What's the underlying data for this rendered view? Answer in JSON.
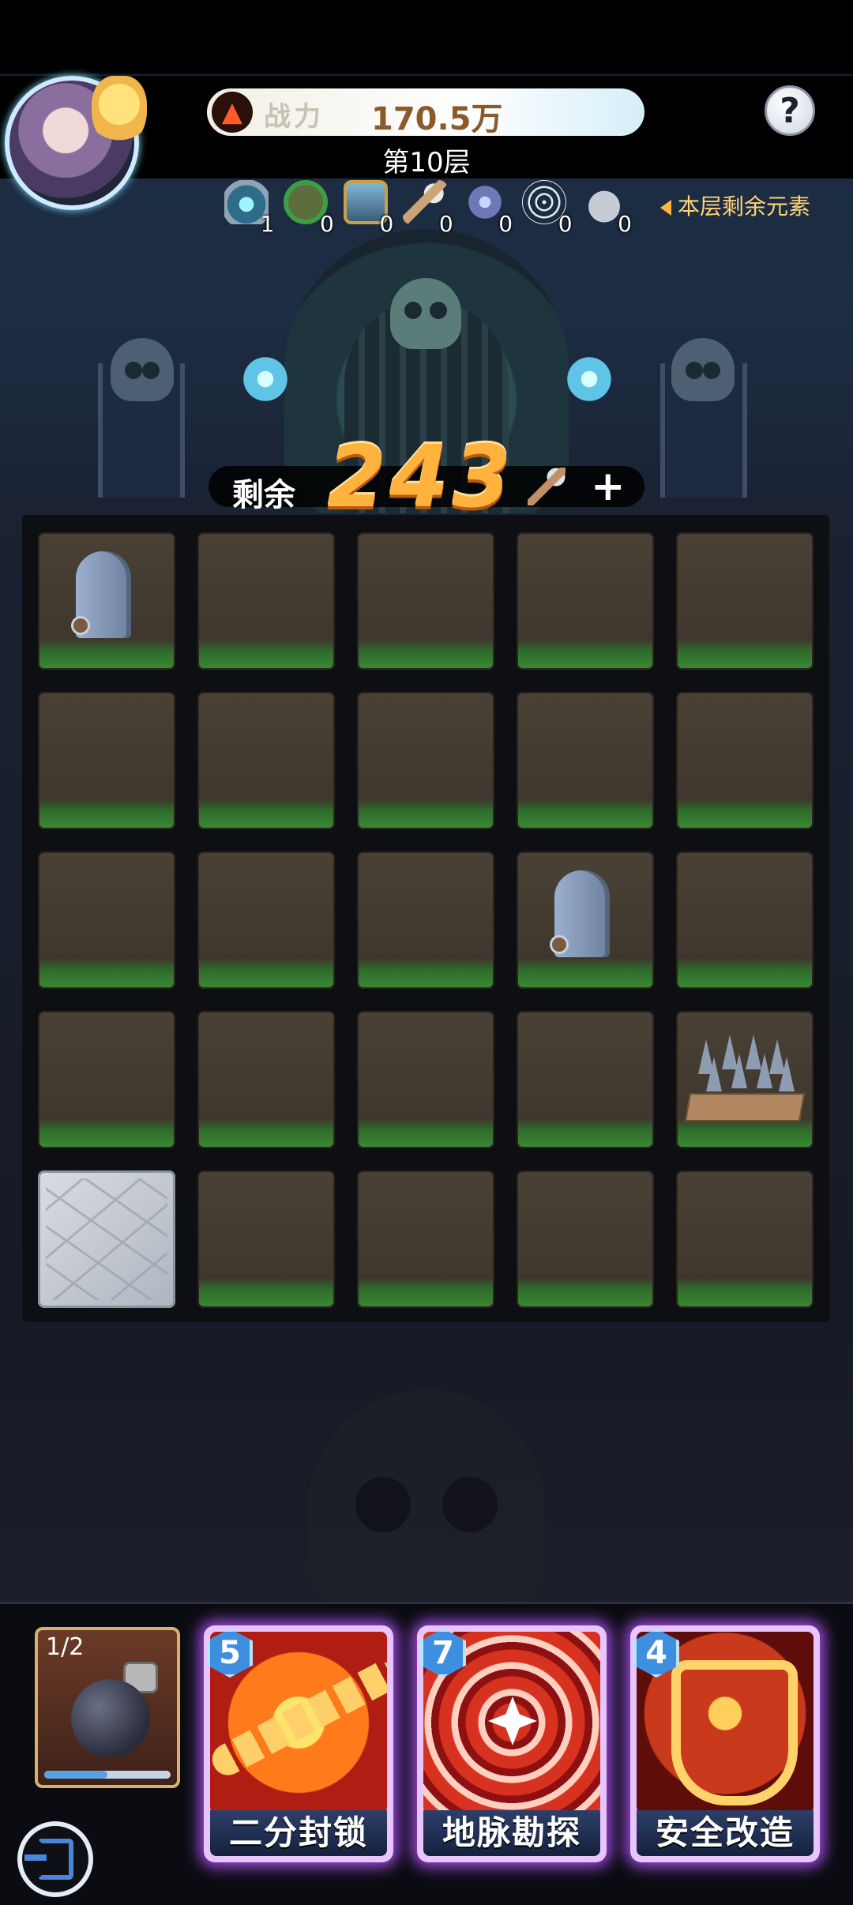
{
  "header": {
    "power_label": "战力",
    "power_value": "170.5万",
    "floor": "第10层",
    "help_glyph": "?",
    "remaining_elements_label": "本层剩余元素",
    "elements": [
      {
        "icon": "portal-icon",
        "count": "1"
      },
      {
        "icon": "ban-icon",
        "count": "0"
      },
      {
        "icon": "locked-chest-icon",
        "count": "0"
      },
      {
        "icon": "pickaxe-icon",
        "count": "0"
      },
      {
        "icon": "shield-badge-icon",
        "count": "0"
      },
      {
        "icon": "spiderweb-icon",
        "count": "0"
      },
      {
        "icon": "rock-icon",
        "count": "0"
      }
    ]
  },
  "counter": {
    "label": "剩余",
    "value": "243",
    "add_glyph": "+"
  },
  "grid": {
    "rows": 5,
    "cols": 5,
    "tiles": [
      [
        "tombstone",
        "dirt",
        "dirt",
        "dirt",
        "dirt"
      ],
      [
        "dirt",
        "dirt",
        "dirt",
        "dirt",
        "dirt"
      ],
      [
        "dirt",
        "dirt",
        "dirt",
        "tombstone",
        "dirt"
      ],
      [
        "dirt",
        "dirt",
        "dirt",
        "dirt",
        "spikes"
      ],
      [
        "stone",
        "dirt",
        "dirt",
        "dirt",
        "dirt"
      ]
    ]
  },
  "bottom": {
    "bomb_uses": "1/2",
    "bomb_progress": 0.5,
    "skills": [
      {
        "cost": "5",
        "name": "二分封锁",
        "art": "chain"
      },
      {
        "cost": "7",
        "name": "地脉勘探",
        "art": "quake"
      },
      {
        "cost": "4",
        "name": "安全改造",
        "art": "shield"
      }
    ]
  },
  "colors": {
    "accent_orange": "#ffb23e",
    "skill_glow": "#9e4ce0",
    "cost_blue": "#3f8fe0",
    "grass_green": "#3b8a33"
  }
}
